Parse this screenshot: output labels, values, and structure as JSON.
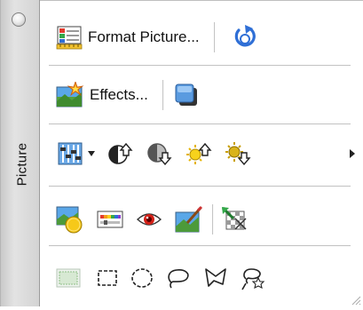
{
  "palette": {
    "title": "Picture"
  },
  "toolbar": {
    "format_picture_label": "Format Picture...",
    "effects_label": "Effects..."
  },
  "icons": {
    "row1": [
      "format-picture-icon",
      "reset-picture-icon"
    ],
    "row2": [
      "effects-icon",
      "shadow-icon"
    ],
    "row3": [
      "image-control-icon",
      "dropdown-arrow-icon",
      "more-contrast-icon",
      "less-contrast-icon",
      "more-brightness-icon",
      "less-brightness-icon",
      "overflow-arrow-icon"
    ],
    "row4": [
      "recolor-picture-icon",
      "color-adjust-icon",
      "red-eye-icon",
      "fix-picture-icon",
      "transparent-color-icon"
    ],
    "row5": [
      "select-all-icon",
      "rectangular-marquee-icon",
      "oval-marquee-icon",
      "lasso-icon",
      "polygonal-lasso-icon",
      "magic-lasso-icon"
    ]
  },
  "colors": {
    "sidebar": "#d3d3d3",
    "background": "#ffffff",
    "separator": "#c4c4c4",
    "accent_blue": "#2f6fd6"
  }
}
